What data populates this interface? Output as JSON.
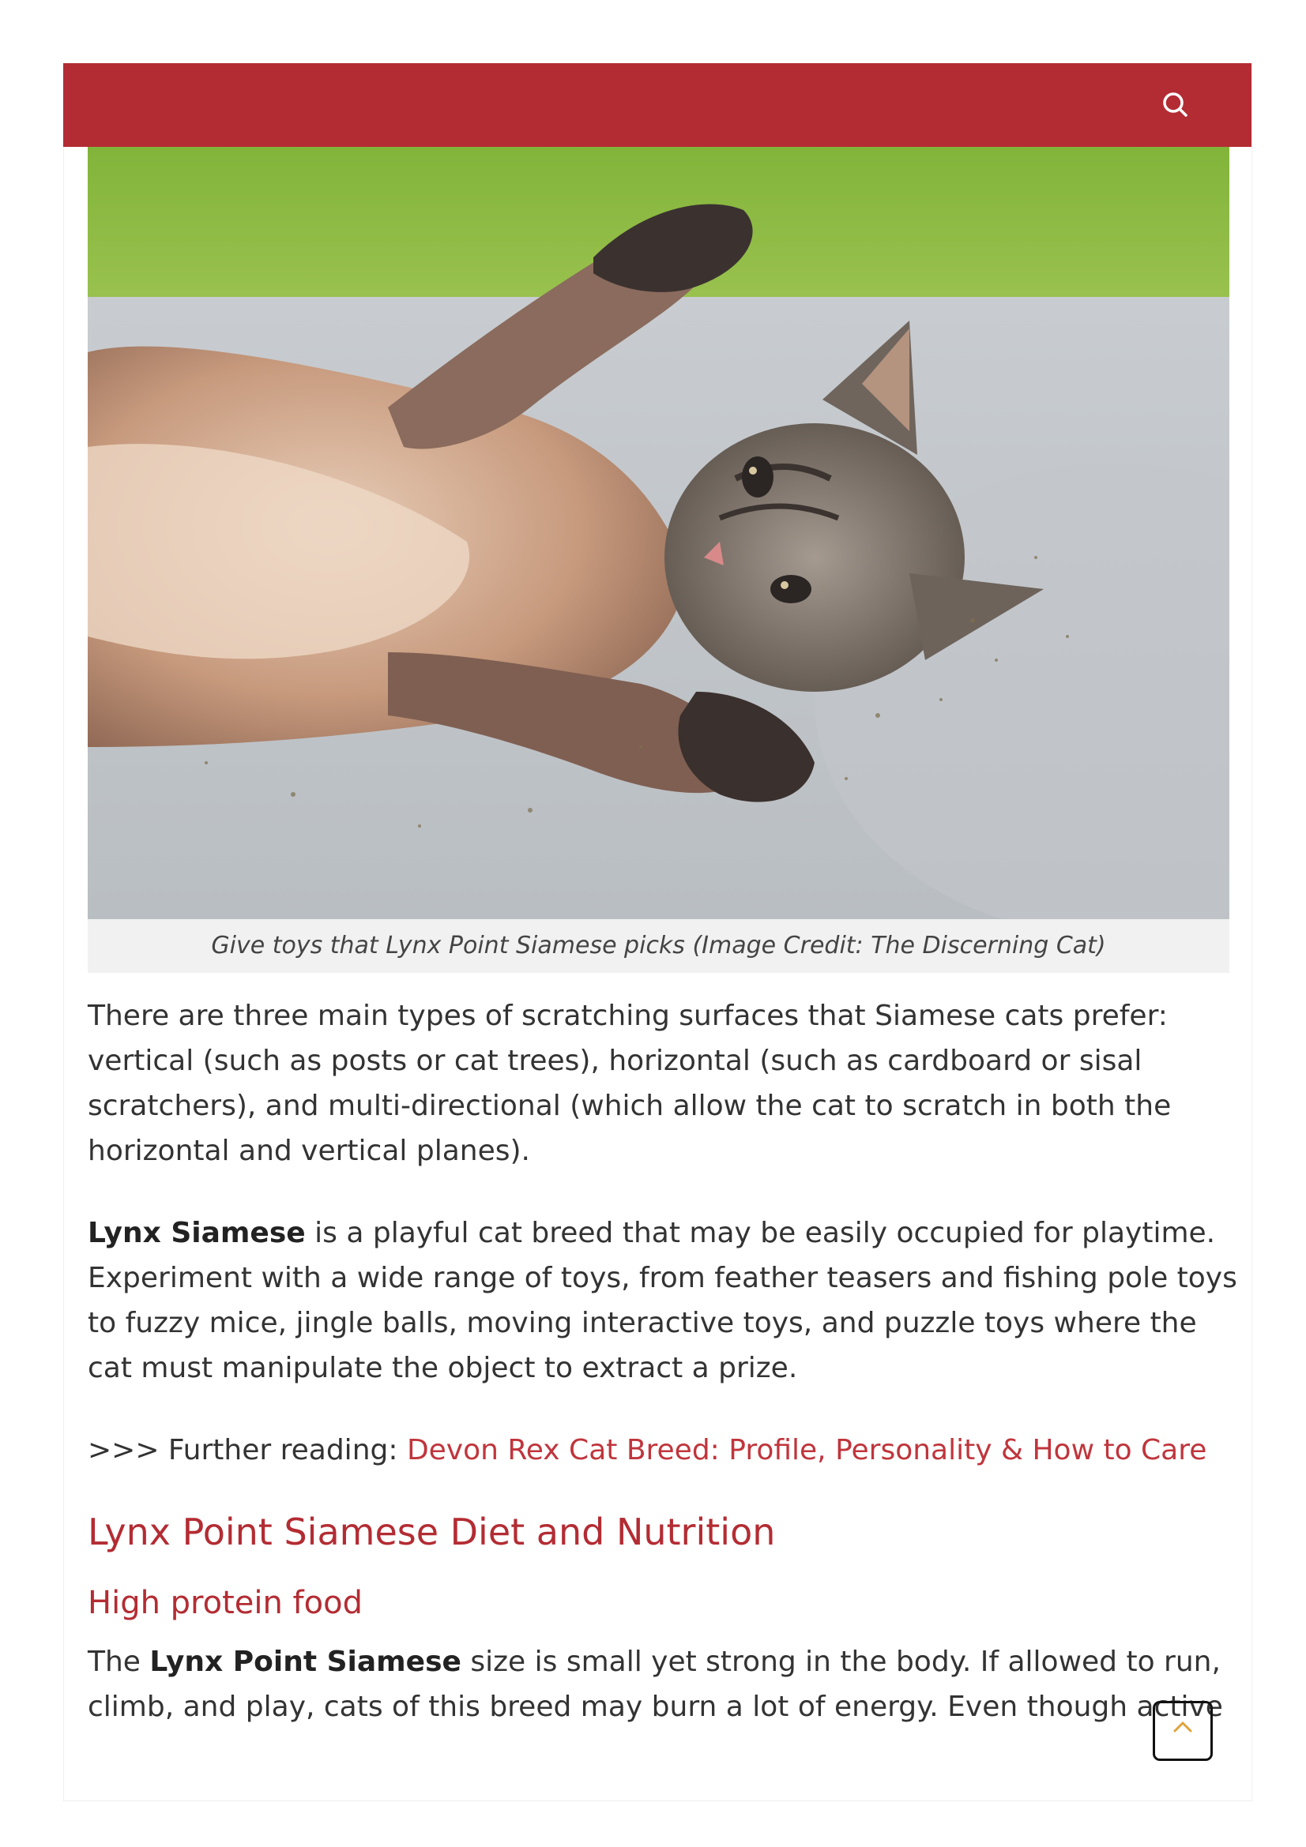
{
  "header": {
    "search_icon": "search-icon",
    "bar_color": "#b32c33"
  },
  "figure": {
    "caption": "Give toys that Lynx Point Siamese picks (Image Credit: The Discerning Cat)"
  },
  "article": {
    "para1": "There are three main types of scratching surfaces that Siamese cats prefer: vertical (such as posts or cat trees), horizontal (such as cardboard or sisal scratchers), and multi-directional (which allow the cat to scratch in both the horizontal and vertical planes).",
    "para2_bold": "Lynx Siamese",
    "para2_rest": " is a playful cat breed that may be easily occupied for playtime. Experiment with a wide range of toys, from feather teasers and fishing pole toys to fuzzy mice, jingle balls, moving interactive toys, and puzzle toys where the cat must manipulate the object to extract a prize.",
    "further_prefix": ">>> Further reading: ",
    "further_link": "Devon Rex Cat Breed: Profile, Personality & How to Care",
    "heading2": "Lynx Point Siamese Diet and Nutrition",
    "heading3": "High protein food",
    "para4_start": "The ",
    "para4_bold": "Lynx Point Siamese",
    "para4_rest": " size is small yet strong in the body. If allowed to run, climb, and play, cats of this breed may burn a lot of energy. Even though active"
  },
  "controls": {
    "scroll_top_icon": "chevron-up-icon",
    "link_color": "#c0353c"
  }
}
